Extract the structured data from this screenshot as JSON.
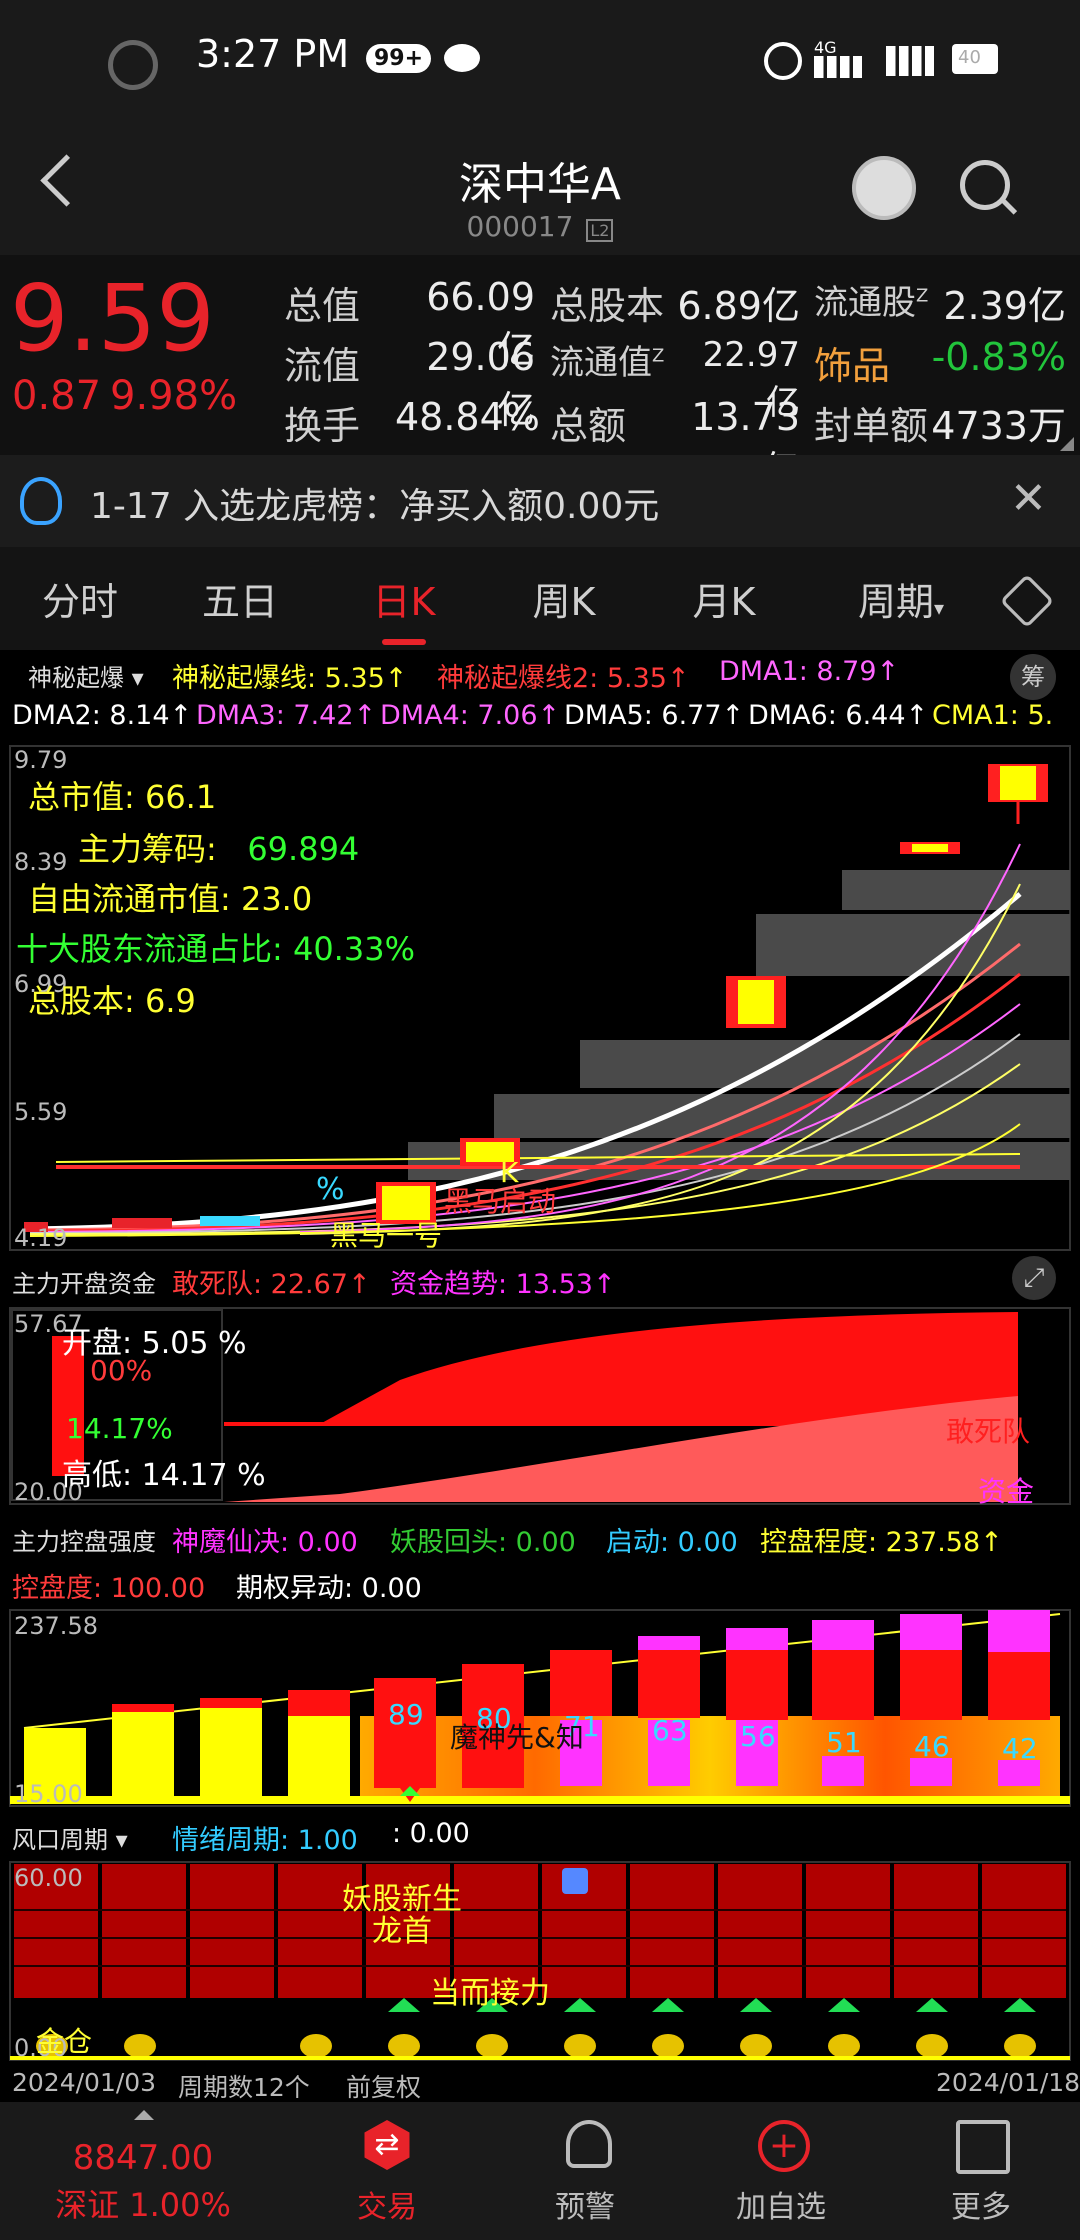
{
  "status_bar": {
    "time": "3:27 PM",
    "badge": "99+",
    "net1": "4G",
    "battery": "40"
  },
  "header": {
    "title": "深中华A",
    "code": "000017",
    "code_badge": "L2"
  },
  "quote": {
    "price": "9.59",
    "change": "0.87",
    "change_pct": "9.98%",
    "rows": [
      [
        {
          "label": "总值",
          "value": "66.09亿"
        },
        {
          "label": "总股本",
          "value": "6.89亿"
        },
        {
          "label": "流通股",
          "sup": "Z",
          "value": "2.39亿"
        }
      ],
      [
        {
          "label": "流值",
          "value": "29.06亿"
        },
        {
          "label": "流通值",
          "sup": "Z",
          "value": "22.97亿"
        },
        {
          "label": "饰品",
          "value": "-0.83%"
        }
      ],
      [
        {
          "label": "换手",
          "value": "48.84%"
        },
        {
          "label": "总额",
          "value": "13.73亿"
        },
        {
          "label": "封单额",
          "value": "4733万"
        }
      ]
    ]
  },
  "notice": {
    "text": "1-17 入选龙虎榜：净买入额0.00元"
  },
  "tabs": [
    "分时",
    "五日",
    "日K",
    "周K",
    "月K",
    "周期"
  ],
  "ind1": {
    "selector": "神秘起爆",
    "items": [
      {
        "label": "神秘起爆线: 5.35↑",
        "color": "#ffff33"
      },
      {
        "label": "神秘起爆线2: 5.35↑",
        "color": "#ff3b3b"
      },
      {
        "label": "DMA1: 8.79↑",
        "color": "#ff66ff"
      },
      {
        "label": "DMA2: 8.14↑",
        "color": "#ffffff"
      },
      {
        "label": "DMA3: 7.42↑",
        "color": "#ff66ff"
      },
      {
        "label": "DMA4: 7.06↑",
        "color": "#ff66ff"
      },
      {
        "label": "DMA5: 6.77↑",
        "color": "#ffffff"
      },
      {
        "label": "DMA6: 6.44↑",
        "color": "#ffffff"
      },
      {
        "label": "CMA1: 5.",
        "color": "#ffff33"
      }
    ],
    "calc_btn": "筹"
  },
  "kchart": {
    "y_ticks": [
      "9.79",
      "8.39",
      "6.99",
      "5.59",
      "4.19"
    ],
    "overlay": [
      {
        "text": "总市值:  66.1",
        "color": "#ffff33"
      },
      {
        "text": "主力筹码:",
        "color": "#ffff33",
        "extra": "69.894",
        "extra_color": "#33ff33"
      },
      {
        "text": "自由流通市值:  23.0",
        "color": "#ffff33"
      },
      {
        "text": "十大股东流通占比:  40.33%",
        "color": "#33ff33"
      },
      {
        "text": "总股本:  6.9",
        "color": "#ffff33"
      }
    ],
    "marks": {
      "pct": "%",
      "k": "K",
      "black_horse": "黑马启动",
      "black_one": "黑马一号"
    }
  },
  "ind2": {
    "selector": "主力开盘资金",
    "items": [
      {
        "label": "敢死队: 22.67↑",
        "color": "#ff3b3b"
      },
      {
        "label": "资金趋势: 13.53↑",
        "color": "#ff33ff"
      }
    ],
    "y_top": "57.67",
    "y_bottom": "20.00",
    "open": "开盘:  5.05 %",
    "pct_red": "00%",
    "pct_green": "14.17%",
    "high_low": "高低:  14.17 %",
    "lbl_gansi": "敢死队",
    "lbl_zijin": "资金"
  },
  "ind3": {
    "selector": "主力控盘强度",
    "items": [
      {
        "label": "神魔仙决: 0.00",
        "color": "#ff33ff"
      },
      {
        "label": "妖股回头: 0.00",
        "color": "#33cc33"
      },
      {
        "label": "启动: 0.00",
        "color": "#33ccff"
      },
      {
        "label": "控盘程度: 237.58↑",
        "color": "#ffff33"
      },
      {
        "label": "控盘度: 100.00",
        "color": "#ff3b3b"
      },
      {
        "label": "期权异动: 0.00",
        "color": "#ffffff"
      }
    ],
    "y_top": "237.58",
    "y_bottom": "15.00",
    "bar_labels": [
      "89",
      "80",
      "71",
      "63",
      "56",
      "51",
      "46",
      "42"
    ],
    "mid_text": "魔神先&知"
  },
  "ind4": {
    "selector": "风口周期",
    "items": [
      {
        "label": "情绪周期: 1.00",
        "color": "#33ccff"
      },
      {
        "label": ": 0.00",
        "color": "#ffffff"
      }
    ],
    "y_top": "60.00",
    "y_bottom": "0.00",
    "texts": {
      "a": "妖股新生",
      "b": "龙首",
      "c": "当而接力",
      "d": "金仓"
    }
  },
  "footer": {
    "start": "2024/01/03",
    "period": "周期数12个",
    "adj": "前复权",
    "end": "2024/01/18"
  },
  "bottom_nav": {
    "index_value": "8847.00",
    "index_label": "深证 1.00%",
    "items": [
      {
        "label": "交易",
        "color": "#e8232a"
      },
      {
        "label": "预警",
        "color": "#bdbdbd"
      },
      {
        "label": "加自选",
        "color": "#bdbdbd"
      },
      {
        "label": "更多",
        "color": "#bdbdbd"
      }
    ]
  },
  "colors": {
    "up": "#e8232a",
    "down": "#22c53c",
    "accent": "#e8232a",
    "bg": "#000000"
  }
}
